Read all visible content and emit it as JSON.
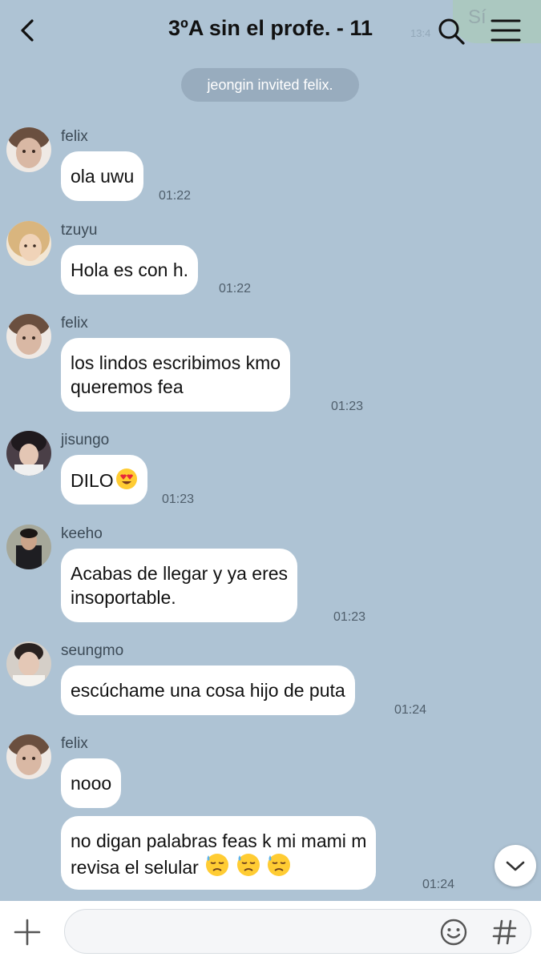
{
  "header": {
    "title": "3ºA sin el profe. - 11",
    "peek_text": "Sí",
    "peek_time": "13:4"
  },
  "system_message": "jeongin invited felix.",
  "messages": [
    {
      "sender": "felix",
      "lines": [
        "ola uwu"
      ],
      "time": "01:22",
      "avatar": "felix-avatar",
      "avatar_color": "#d9b8a4"
    },
    {
      "sender": "tzuyu",
      "lines": [
        "Hola es con h."
      ],
      "time": "01:22",
      "avatar": "tzuyu-avatar",
      "avatar_color": "#e6c7a3"
    },
    {
      "sender": "felix",
      "lines": [
        "los lindos escribimos kmo",
        "queremos fea"
      ],
      "time": "01:23",
      "avatar": "felix-avatar",
      "avatar_color": "#d9b8a4"
    },
    {
      "sender": "jisungo",
      "lines": [
        "DILO"
      ],
      "emojis": [
        "heart-eyes-emoji"
      ],
      "time": "01:23",
      "avatar": "jisungo-avatar",
      "avatar_color": "#6b5f66"
    },
    {
      "sender": "keeho",
      "lines": [
        "Acabas de llegar y ya eres",
        "insoportable."
      ],
      "time": "01:23",
      "avatar": "keeho-avatar",
      "avatar_color": "#3d3a36"
    },
    {
      "sender": "seungmo",
      "lines": [
        "escúchame una cosa hijo de puta"
      ],
      "time": "01:24",
      "avatar": "seungmo-avatar",
      "avatar_color": "#b8aaa0"
    },
    {
      "sender": "felix",
      "lines": [
        "nooo"
      ],
      "time": "",
      "avatar": "felix-avatar",
      "avatar_color": "#d9b8a4"
    },
    {
      "sender": "",
      "lines": [
        "no digan palabras feas k mi mami m",
        "revisa el selular"
      ],
      "emojis": [
        "downcast-sweat-emoji",
        "downcast-sweat-emoji",
        "downcast-sweat-emoji"
      ],
      "time": "01:24"
    }
  ],
  "input": {
    "value": "",
    "placeholder": ""
  },
  "icons": {
    "back": "chevron-left-icon",
    "search": "search-icon",
    "menu": "hamburger-menu-icon",
    "add": "plus-icon",
    "emoji": "emoji-icon",
    "hashtag": "hashtag-icon",
    "scroll": "chevron-down-icon"
  },
  "colors": {
    "chat_background": "#aec3d4",
    "bubble": "#ffffff",
    "system_pill": "#98acbe",
    "text": "#111111"
  }
}
